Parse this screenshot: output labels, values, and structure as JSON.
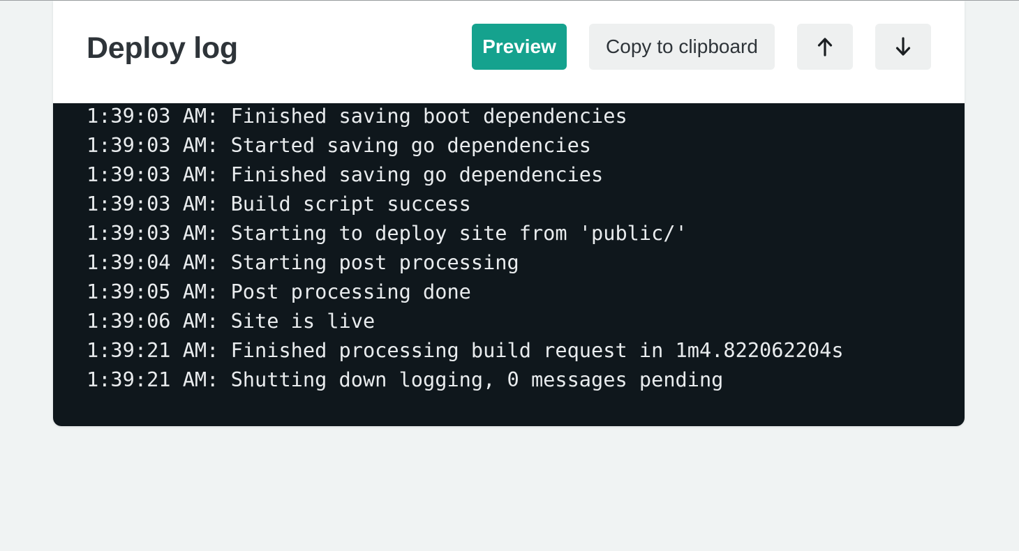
{
  "header": {
    "title": "Deploy log",
    "preview_label": "Preview",
    "copy_label": "Copy to clipboard",
    "scroll_up_icon": "arrow-up-icon",
    "scroll_down_icon": "arrow-down-icon"
  },
  "colors": {
    "accent": "#15a28e",
    "log_background": "#0f171c",
    "page_background": "#f0f3f3"
  },
  "log": {
    "lines": [
      "1:39:03 AM: Finished saving boot dependencies",
      "1:39:03 AM: Started saving go dependencies",
      "1:39:03 AM: Finished saving go dependencies",
      "1:39:03 AM: Build script success",
      "1:39:03 AM: Starting to deploy site from 'public/'",
      "1:39:04 AM: Starting post processing",
      "1:39:05 AM: Post processing done",
      "1:39:06 AM: Site is live",
      "1:39:21 AM: Finished processing build request in 1m4.822062204s",
      "1:39:21 AM: Shutting down logging, 0 messages pending"
    ]
  }
}
